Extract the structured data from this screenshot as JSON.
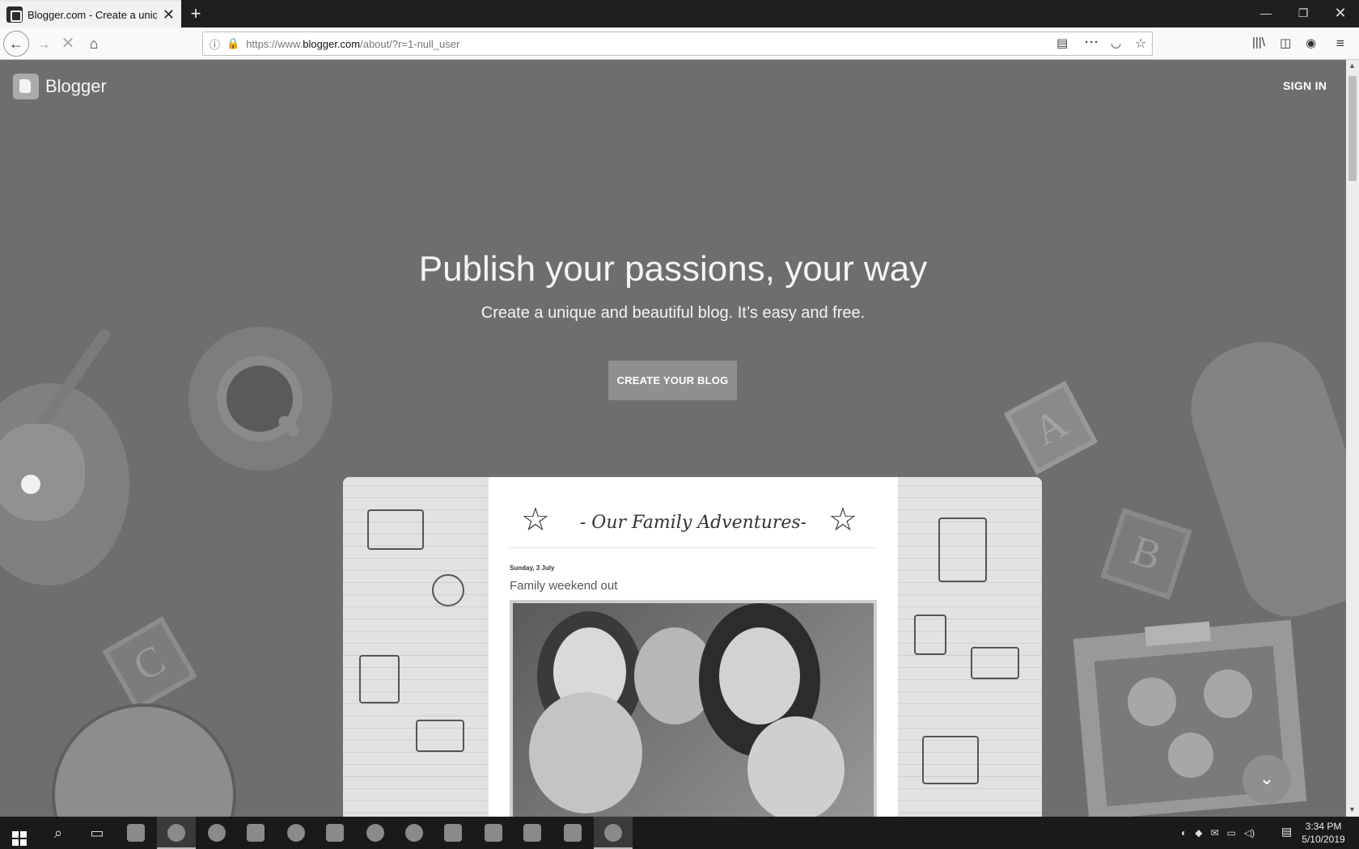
{
  "browser": {
    "tab_title": "Blogger.com - Create a unique",
    "url_prefix": "https://www.",
    "url_domain": "blogger.com",
    "url_path": "/about/?r=1-null_user",
    "new_tab": "+",
    "win_min": "—",
    "win_max": "❐",
    "win_close": "✕",
    "icons": {
      "back": "←",
      "forward": "→",
      "stop": "✕",
      "home": "⌂",
      "info": "ⓘ",
      "lock": "🔒",
      "reader": "▤",
      "more": "···",
      "pocket": "◡",
      "star": "☆",
      "library": "|||\\",
      "sidebar": "◫",
      "account": "◉",
      "menu": "≡",
      "tab_close": "✕"
    }
  },
  "page": {
    "brand_name": "Blogger",
    "sign_in": "SIGN IN",
    "headline": "Publish your passions, your way",
    "subhead": "Create a unique and beautiful blog. It’s easy and free.",
    "cta": "CREATE YOUR BLOG",
    "scroll_down": "⌄",
    "deco_letters": {
      "a": "A",
      "b": "B",
      "c": "C"
    }
  },
  "preview": {
    "blog_title": "- Our Family Adventures-",
    "star": "☆",
    "post_date": "Sunday, 3 July",
    "post_title": "Family weekend out"
  },
  "taskbar": {
    "time": "3:34 PM",
    "date": "5/10/2019",
    "search": "⌕",
    "task_view": "▭",
    "notifications": "▤"
  }
}
